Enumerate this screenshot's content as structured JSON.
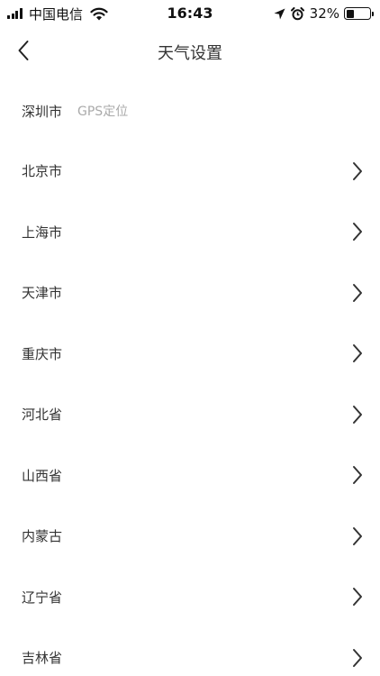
{
  "status_bar": {
    "carrier": "中国电信",
    "time": "16:43",
    "battery_percent": "32%",
    "battery_level": 0.32,
    "icons": [
      "signal-icon",
      "wifi-icon",
      "location-arrow-icon",
      "alarm-icon",
      "battery-icon"
    ]
  },
  "nav": {
    "back_icon": "chevron-left-icon",
    "title": "天气设置"
  },
  "gps": {
    "city": "深圳市",
    "label": "GPS定位"
  },
  "regions": [
    {
      "label": "北京市"
    },
    {
      "label": "上海市"
    },
    {
      "label": "天津市"
    },
    {
      "label": "重庆市"
    },
    {
      "label": "河北省"
    },
    {
      "label": "山西省"
    },
    {
      "label": "内蒙古"
    },
    {
      "label": "辽宁省"
    },
    {
      "label": "吉林省"
    }
  ],
  "colors": {
    "text_primary": "#333333",
    "text_secondary": "#aaaaaa",
    "background": "#ffffff"
  }
}
